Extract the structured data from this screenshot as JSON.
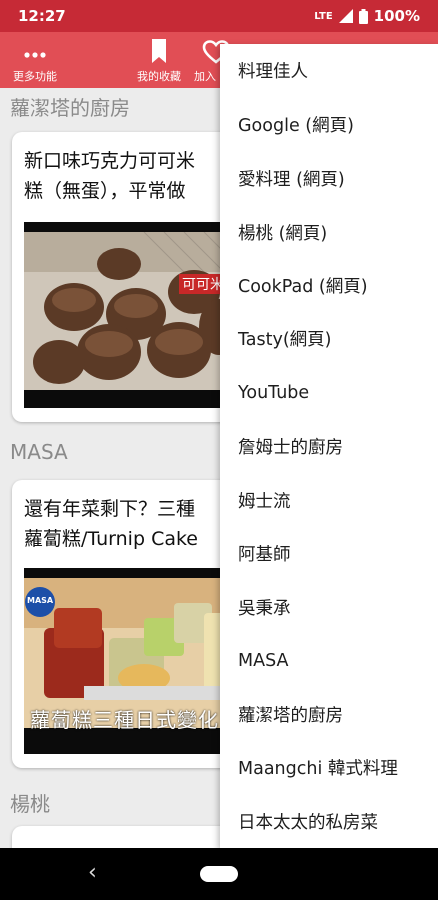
{
  "status": {
    "time": "12:27",
    "network": "LTE",
    "battery": "100%"
  },
  "toolbar": {
    "more_label": "更多功能",
    "favorites_label": "我的收藏",
    "add_label": "加入",
    "icons": [
      "more-dots-icon",
      "bookmark-icon",
      "heart-icon",
      "search-icon",
      "menu-icon"
    ]
  },
  "sections": [
    {
      "title": "蘿潔塔的廚房",
      "card_title": "新口味巧克力可可米\n糕（無蛋），平常做",
      "thumb_caption": "可可米"
    },
    {
      "title": "MASA",
      "card_title": "還有年菜剩下？三種\n蘿蔔糕/Turnip Cake",
      "thumb_caption": "蘿蔔糕三種日式變化",
      "thumb_badge": "MASA"
    },
    {
      "title": "楊桃"
    }
  ],
  "menu": {
    "items": [
      "料理佳人",
      "Google (網頁)",
      "愛料理 (網頁)",
      "楊桃 (網頁)",
      "CookPad (網頁)",
      "Tasty(網頁)",
      "YouTube",
      "詹姆士的廚房",
      "姆士流",
      "阿基師",
      "吳秉承",
      "MASA",
      "蘿潔塔的廚房",
      "Maangchi 韓式料理",
      "日本太太的私房菜"
    ]
  },
  "nav": {
    "back": "‹"
  },
  "colors": {
    "status_bar": "#c62a36",
    "toolbar": "#e14e55",
    "menu_bg": "#ffffff",
    "page_bg": "#ececec"
  }
}
